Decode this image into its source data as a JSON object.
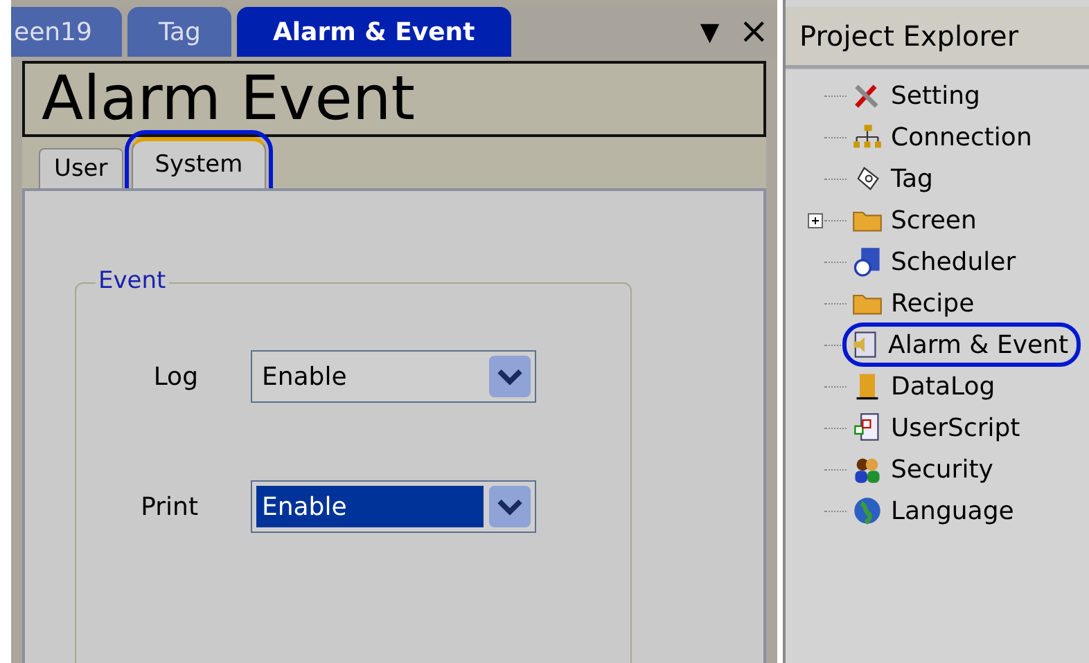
{
  "document_tabs": [
    {
      "label": "een19",
      "selected": false
    },
    {
      "label": "Tag",
      "selected": false
    },
    {
      "label": "Alarm & Event",
      "selected": true
    }
  ],
  "panel_controls": {
    "menu": "▼",
    "close": "×"
  },
  "header": {
    "title": "Alarm  Event"
  },
  "sub_tabs": [
    {
      "label": "User",
      "selected": false,
      "highlighted": false
    },
    {
      "label": "System",
      "selected": true,
      "highlighted": true
    }
  ],
  "group": {
    "title": "Event",
    "fields": [
      {
        "label": "Log",
        "value": "Enable",
        "focused": false
      },
      {
        "label": "Print",
        "value": "Enable",
        "focused": true
      }
    ]
  },
  "project_explorer": {
    "title": "Project Explorer",
    "items": [
      {
        "label": "Setting",
        "collapsible": false,
        "highlighted": false
      },
      {
        "label": "Connection",
        "collapsible": false,
        "highlighted": false
      },
      {
        "label": "Tag",
        "collapsible": false,
        "highlighted": false
      },
      {
        "label": "Screen",
        "collapsible": true,
        "highlighted": false
      },
      {
        "label": "Scheduler",
        "collapsible": false,
        "highlighted": false
      },
      {
        "label": "Recipe",
        "collapsible": false,
        "highlighted": false
      },
      {
        "label": "Alarm & Event",
        "collapsible": false,
        "highlighted": true
      },
      {
        "label": "DataLog",
        "collapsible": false,
        "highlighted": false
      },
      {
        "label": "UserScript",
        "collapsible": false,
        "highlighted": false
      },
      {
        "label": "Security",
        "collapsible": false,
        "highlighted": false
      },
      {
        "label": "Language",
        "collapsible": false,
        "highlighted": false
      }
    ]
  }
}
